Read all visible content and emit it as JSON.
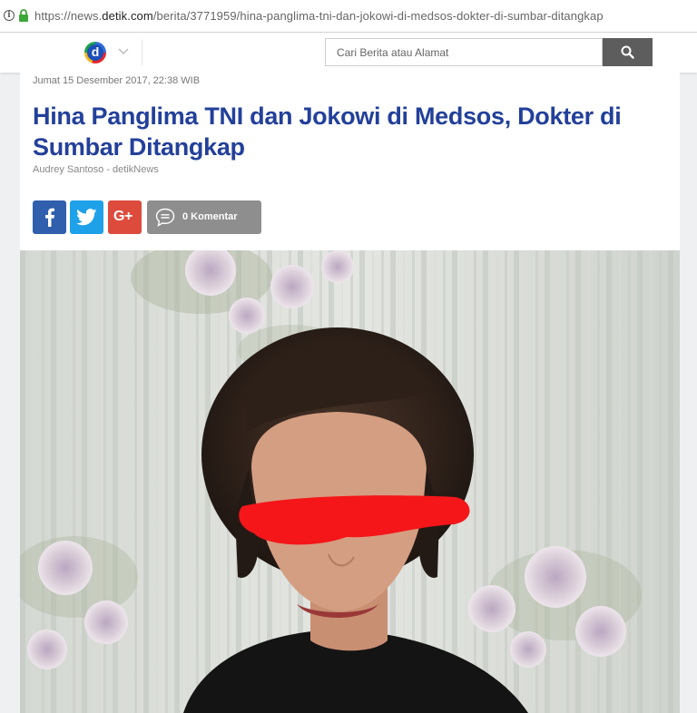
{
  "browser": {
    "url_prefix": "https://news.",
    "url_domain": "detik.com",
    "url_path": "/berita/3771959/hina-panglima-tni-dan-jokowi-di-medsos-dokter-di-sumbar-ditangkap"
  },
  "header": {
    "logo_letter": "d",
    "search_placeholder": "Cari Berita atau Alamat"
  },
  "article": {
    "date": "Jumat 15 Desember 2017, 22:38 WIB",
    "title": "Hina Panglima TNI dan Jokowi di Medsos, Dokter di Sumbar Ditangkap",
    "author": "Audrey Santoso - detikNews",
    "share": {
      "googleplus_label": "G+",
      "comment_label": "0 Komentar"
    }
  },
  "icons": {
    "info": "info-icon",
    "lock": "lock-icon",
    "menu": "chevron-down-icon",
    "search": "search-icon",
    "facebook": "facebook-icon",
    "twitter": "twitter-icon",
    "googleplus": "google-plus-icon",
    "comment": "comment-icon"
  },
  "colors": {
    "title": "#23409a",
    "facebook": "#2f5fad",
    "twitter": "#1ea1e9",
    "googleplus": "#dd4b3d",
    "comment": "#8e8e8e",
    "search_button": "#5d5d5d",
    "lock": "#3ea639"
  }
}
